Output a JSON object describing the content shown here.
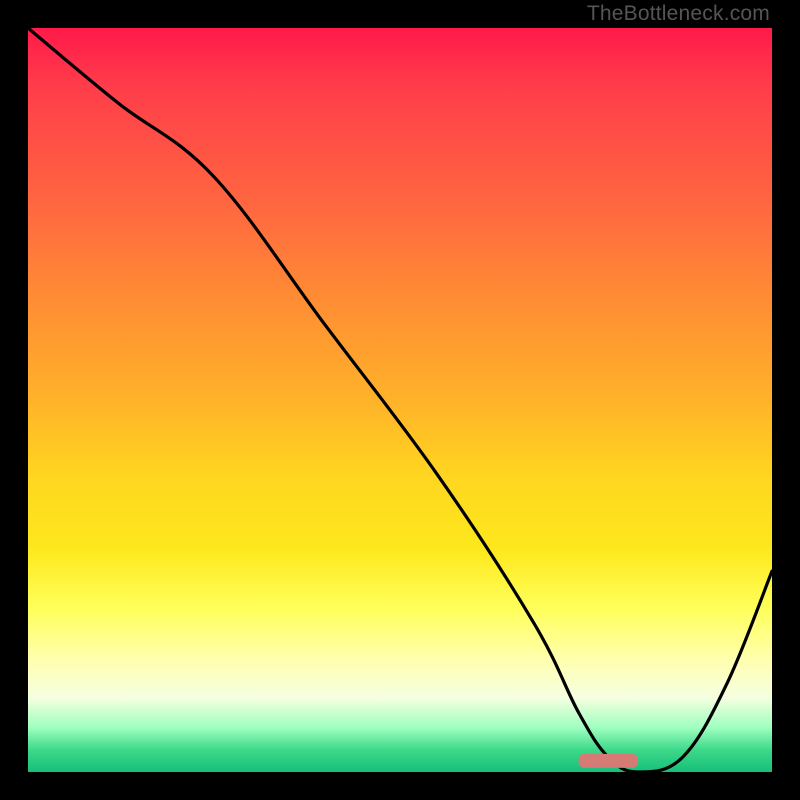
{
  "watermark": "TheBottleneck.com",
  "chart_data": {
    "type": "line",
    "title": "",
    "xlabel": "",
    "ylabel": "",
    "xlim": [
      0,
      100
    ],
    "ylim": [
      0,
      100
    ],
    "x": [
      0,
      12,
      25,
      40,
      55,
      68,
      74,
      78,
      82,
      88,
      94,
      100
    ],
    "values": [
      100,
      90,
      80,
      60,
      40,
      20,
      8,
      2,
      0,
      2,
      12,
      27
    ],
    "marker": {
      "x_start": 74,
      "x_end": 82,
      "y": 1.5,
      "color": "#d67a75"
    },
    "gradient_stops": [
      {
        "pos": 0,
        "color": "#ff1a4a"
      },
      {
        "pos": 25,
        "color": "#ff6a3f"
      },
      {
        "pos": 50,
        "color": "#ffb229"
      },
      {
        "pos": 70,
        "color": "#fde81c"
      },
      {
        "pos": 85,
        "color": "#ffffb0"
      },
      {
        "pos": 97,
        "color": "#3ed98a"
      },
      {
        "pos": 100,
        "color": "#16bf7a"
      }
    ]
  }
}
